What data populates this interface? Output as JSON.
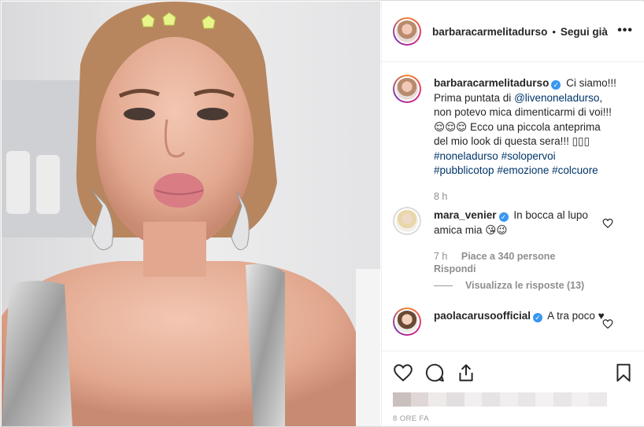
{
  "post": {
    "username": "barbaracarmelitadurso",
    "follow_label": "Segui già",
    "more_label": "•••"
  },
  "caption": {
    "username": "barbaracarmelitadurso",
    "text_1": "Ci siamo!!! Prima puntata di ",
    "mention": "@livenoneladurso",
    "text_2": ", non potevo mica dimenticarmi di voi!!! 😌😌😌 Ecco una piccola anteprima del mio look di questa sera!!! ▯▯▯",
    "hashtags": [
      "#noneladurso",
      "#solopervoi",
      "#pubblicotop",
      "#emozione",
      "#colcuore"
    ],
    "time": "8 h"
  },
  "comments": [
    {
      "username": "mara_venier",
      "text": "In bocca al lupo amica mia 😘😉",
      "time": "7 h",
      "likes": "Piace a 340 persone",
      "reply_label": "Rispondi",
      "view_replies": "Visualizza le risposte (13)"
    },
    {
      "username": "paolacarusoofficial",
      "text": "A tra poco ♥"
    }
  ],
  "footer": {
    "time_ago": "8 ORE FA"
  },
  "colors": {
    "link": "#003569",
    "verified": "#3897f0",
    "meta": "#8e8e8e"
  },
  "icons": [
    "heart-icon",
    "comment-icon",
    "share-icon",
    "bookmark-icon",
    "more-icon",
    "verified-icon"
  ]
}
